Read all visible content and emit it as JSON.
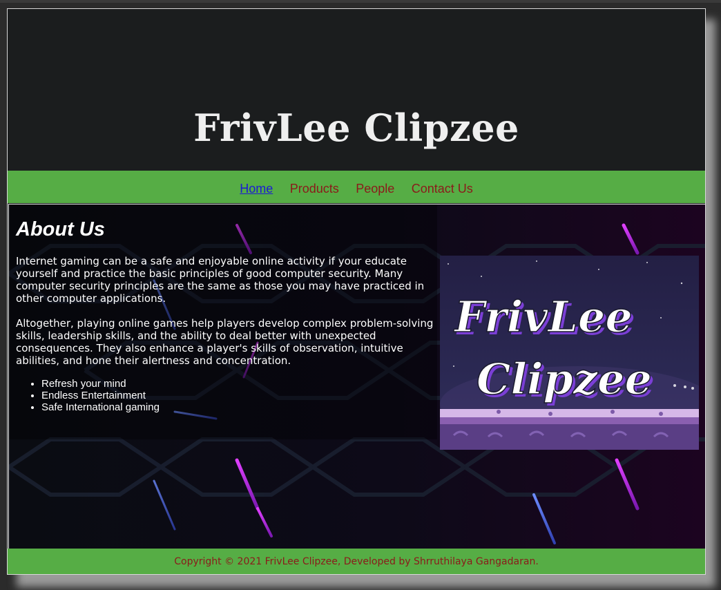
{
  "site": {
    "title": "FrivLee Clipzee"
  },
  "nav": {
    "items": [
      {
        "label": "Home",
        "current": true
      },
      {
        "label": "Products",
        "current": false
      },
      {
        "label": "People",
        "current": false
      },
      {
        "label": "Contact Us",
        "current": false
      }
    ]
  },
  "about": {
    "heading": "About Us",
    "paragraph1": "Internet gaming can be a safe and enjoyable online activity if your educate yourself and practice the basic principles of good computer security. Many computer security principles are the same as those you may have practiced in other computer applications.",
    "paragraph2": "Altogether, playing online games help players develop complex problem-solving skills, leadership skills, and the ability to deal better with unexpected consequences. They also enhance a player's skills of observation, intuitive abilities, and hone their alertness and concentration.",
    "list": [
      "Refresh your mind",
      "Endless Entertainment",
      "Safe International gaming"
    ]
  },
  "image": {
    "logo_line1": "FrivLee",
    "logo_line2": "Clipzee"
  },
  "footer": {
    "text": "Copyright © 2021 FrivLee Clipzee, Developed by Shrruthilaya Gangadaran."
  },
  "colors": {
    "header_bg": "#1b1d1e",
    "nav_bg": "#56ad45",
    "link_color": "#8b1a1a",
    "current_link": "#1a1ad4",
    "neon": "#c025e8"
  }
}
